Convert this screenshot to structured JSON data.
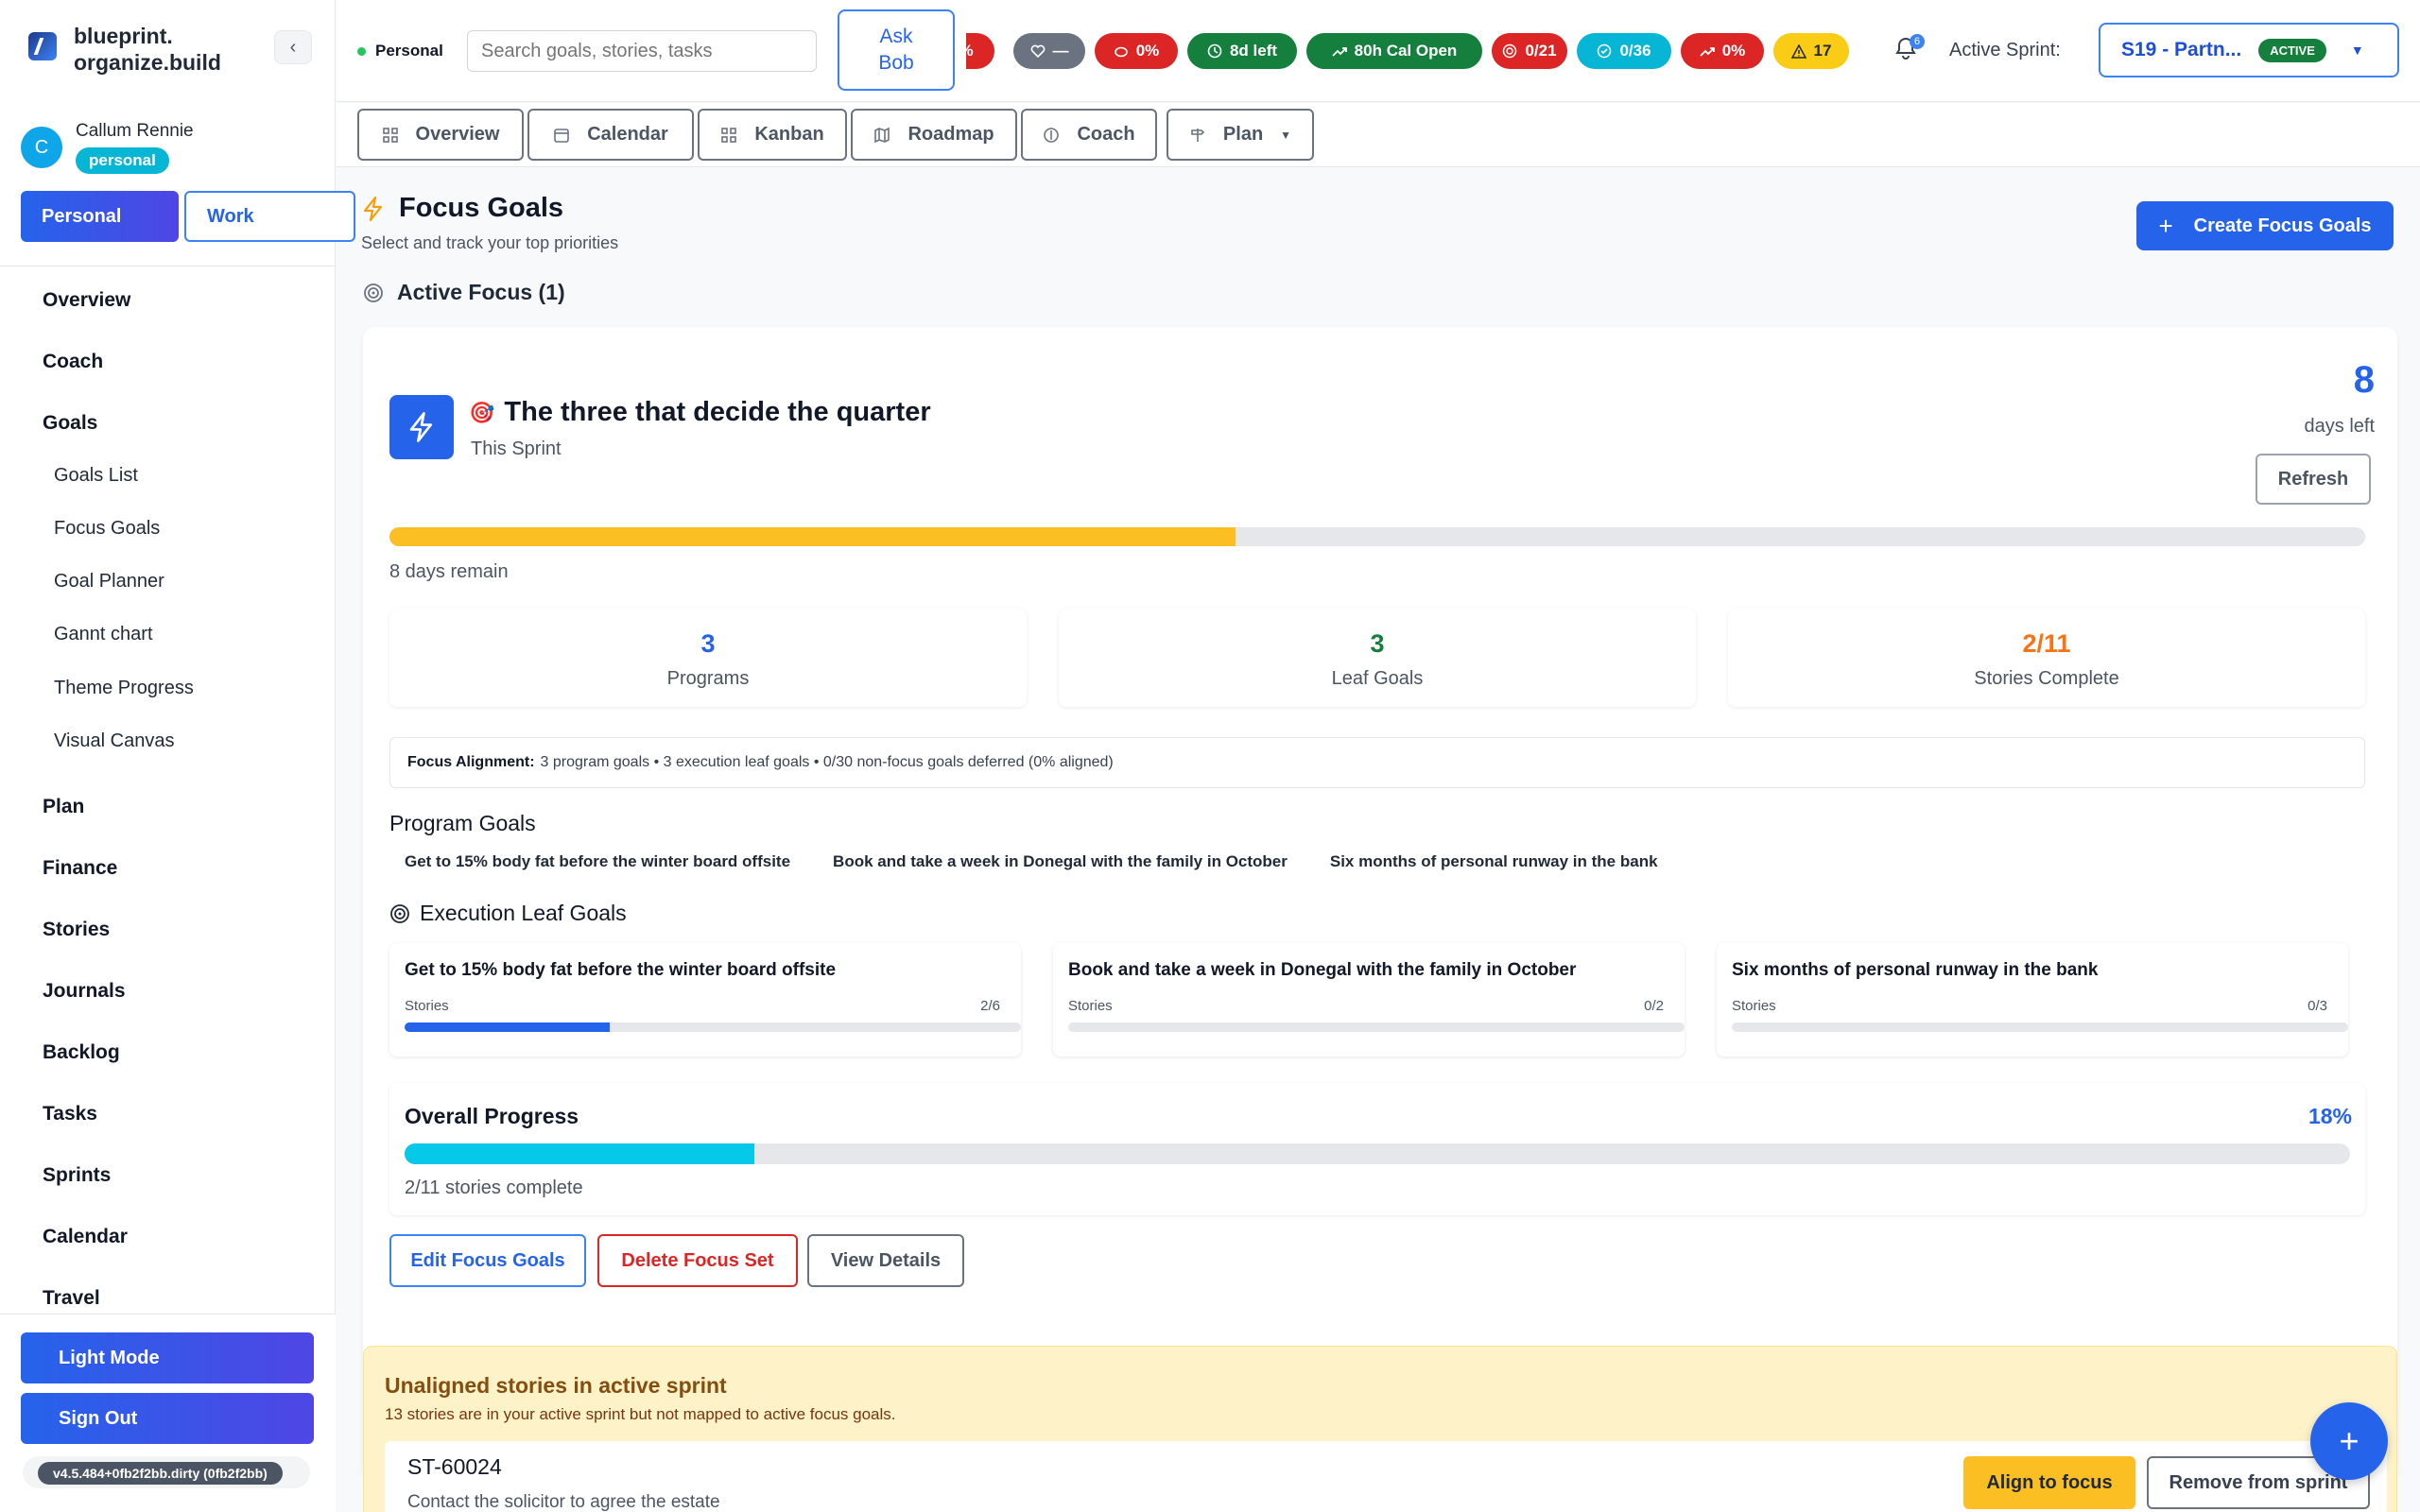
{
  "brand": {
    "name": "blueprint.\norganize.build"
  },
  "user": {
    "initial": "C",
    "name": "Callum Rennie",
    "badge": "personal"
  },
  "context": {
    "personal": "Personal",
    "work": "Work"
  },
  "nav": {
    "overview": "Overview",
    "coach": "Coach",
    "goals": "Goals",
    "goals_list": "Goals List",
    "focus_goals": "Focus Goals",
    "goal_planner": "Goal Planner",
    "gantt": "Gannt chart",
    "theme_progress": "Theme Progress",
    "visual_canvas": "Visual Canvas",
    "plan": "Plan",
    "finance": "Finance",
    "stories": "Stories",
    "journals": "Journals",
    "backlog": "Backlog",
    "tasks": "Tasks",
    "sprints": "Sprints",
    "calendar": "Calendar",
    "travel": "Travel"
  },
  "sidebar_bottom": {
    "light_mode": "Light Mode",
    "sign_out": "Sign Out",
    "version": "v4.5.484+0fb2f2bb.dirty (0fb2f2bb)"
  },
  "topbar": {
    "context": "Personal",
    "search_placeholder": "Search goals, stories, tasks",
    "ask_bob": "Ask Bob",
    "pills": [
      {
        "label": "%",
        "icon": "",
        "color": "#dc2626"
      },
      {
        "label": "—",
        "icon": "heart-pulse-icon",
        "color": "#6b7280"
      },
      {
        "label": "0%",
        "icon": "piggy-bank-icon",
        "color": "#dc2626"
      },
      {
        "label": "8d left",
        "icon": "clock-icon",
        "color": "#15803d"
      },
      {
        "label": "80h Cal Open",
        "icon": "trend-up-icon",
        "color": "#15803d"
      },
      {
        "label": "0/21",
        "icon": "target-icon",
        "color": "#dc2626"
      },
      {
        "label": "0/36",
        "icon": "check-circle-icon",
        "color": "#06b6d4"
      },
      {
        "label": "0%",
        "icon": "trend-up-icon",
        "color": "#dc2626"
      },
      {
        "label": "17",
        "icon": "warning-icon",
        "color": "#facc15"
      }
    ],
    "notif_count": "6",
    "active_sprint_label": "Active Sprint:",
    "sprint_name": "S19 - Partn...",
    "sprint_status": "ACTIVE"
  },
  "tabs": {
    "overview": "Overview",
    "calendar": "Calendar",
    "kanban": "Kanban",
    "roadmap": "Roadmap",
    "coach": "Coach",
    "plan": "Plan"
  },
  "page": {
    "title": "Focus Goals",
    "subtitle": "Select and track your top priorities",
    "create_button": "Create Focus Goals",
    "active_focus": "Active Focus (1)"
  },
  "focus": {
    "emoji": "🎯",
    "name": "The three that decide the quarter",
    "when": "This Sprint",
    "days_left_value": "8",
    "days_left_label": "days left",
    "refresh": "Refresh",
    "sprint_progress": 0.428,
    "days_remain": "8 days remain",
    "stats": [
      {
        "value": "3",
        "label": "Programs",
        "color": "#2563eb"
      },
      {
        "value": "3",
        "label": "Leaf Goals",
        "color": "#15803d"
      },
      {
        "value": "2/11",
        "label": "Stories Complete",
        "color": "#f97316"
      }
    ],
    "alignment_label": "Focus Alignment:",
    "alignment_text": "3 program goals • 3 execution leaf goals • 0/30 non-focus goals deferred (0% aligned)",
    "program_goals_title": "Program Goals",
    "program_goals": [
      "Get to 15% body fat before the winter board offsite",
      "Book and take a week in Donegal with the family in October",
      "Six months of personal runway in the bank"
    ],
    "leaf_goals_title": "Execution Leaf Goals",
    "leaf_goals": [
      {
        "title": "Get to 15% body fat before the winter board offsite",
        "stories_label": "Stories",
        "count": "2/6",
        "progress": 0.333
      },
      {
        "title": "Book and take a week in Donegal with the family in October",
        "stories_label": "Stories",
        "count": "0/2",
        "progress": 0
      },
      {
        "title": "Six months of personal runway in the bank",
        "stories_label": "Stories",
        "count": "0/3",
        "progress": 0
      }
    ],
    "overall_title": "Overall Progress",
    "overall_pct": "18%",
    "overall_progress": 0.18,
    "overall_sub": "2/11 stories complete",
    "edit": "Edit Focus Goals",
    "delete": "Delete Focus Set",
    "details": "View Details"
  },
  "unaligned": {
    "title": "Unaligned stories in active sprint",
    "subtitle": "13 stories are in your active sprint but not mapped to active focus goals.",
    "story_id": "ST-60024",
    "story_title": "Contact the solicitor to agree the estate",
    "align": "Align to focus",
    "remove": "Remove from sprint"
  },
  "fab": "+"
}
